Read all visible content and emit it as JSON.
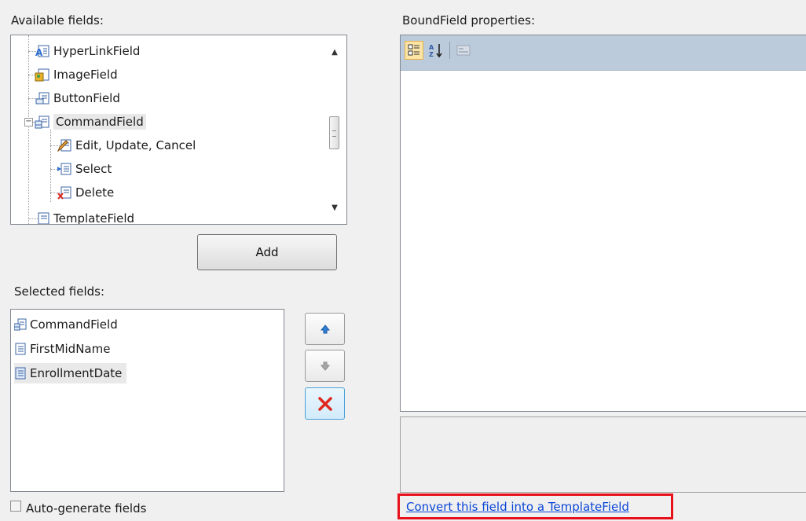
{
  "available_label": "Available fields:",
  "properties_label": "BoundField properties:",
  "selected_label": "Selected fields:",
  "tree": {
    "hyperlink": "HyperLinkField",
    "image": "ImageField",
    "button": "ButtonField",
    "command": "CommandField",
    "edit": "Edit, Update, Cancel",
    "select": "Select",
    "delete": "Delete",
    "template": "TemplateField"
  },
  "add_label": "Add",
  "selected_fields": [
    "CommandField",
    "FirstMidName",
    "EnrollmentDate"
  ],
  "autogen_label": "Auto-generate fields",
  "convert_link": "Convert this field into a TemplateField",
  "icons": {
    "categorized": "categorized-icon",
    "alphabetical": "sort-alphabetical-icon",
    "property_pages": "property-pages-icon",
    "move_up": "arrow-up-icon",
    "move_down": "arrow-down-icon",
    "delete": "delete-x-icon"
  }
}
